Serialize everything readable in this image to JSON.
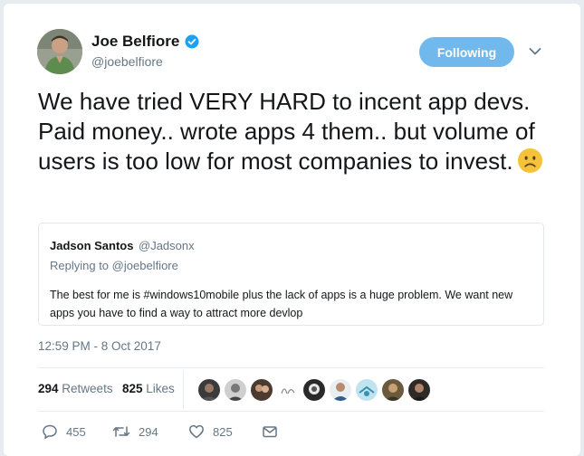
{
  "tweet": {
    "author": {
      "name": "Joe Belfiore",
      "handle": "@joebelfiore",
      "verified": true
    },
    "follow_button_label": "Following",
    "text": "We have tried VERY HARD to incent app devs. Paid money.. wrote apps 4 them.. but volume of users is too low for most companies to invest.",
    "emoji": "frowning-face-emoji",
    "quoted": {
      "name": "Jadson Santos",
      "handle": "@Jadsonx",
      "reply_prefix": "Replying to",
      "reply_to": "@joebelfiore",
      "text": "The best for me is #windows10mobile  plus the lack of apps is a huge problem. We want new apps you have to find a way to attract more devlop"
    },
    "timestamp": "12:59 PM - 8 Oct 2017",
    "stats": {
      "retweets_count": "294",
      "retweets_label": "Retweets",
      "likes_count": "825",
      "likes_label": "Likes"
    },
    "actions": {
      "reply_count": "455",
      "retweet_count": "294",
      "like_count": "825"
    }
  },
  "colors": {
    "background": "#e6ecf0",
    "accent": "#71b9ec",
    "secondary_text": "#657786",
    "primary_text": "#14171a",
    "verified": "#1da1f2",
    "emoji": "#f5c33b"
  }
}
